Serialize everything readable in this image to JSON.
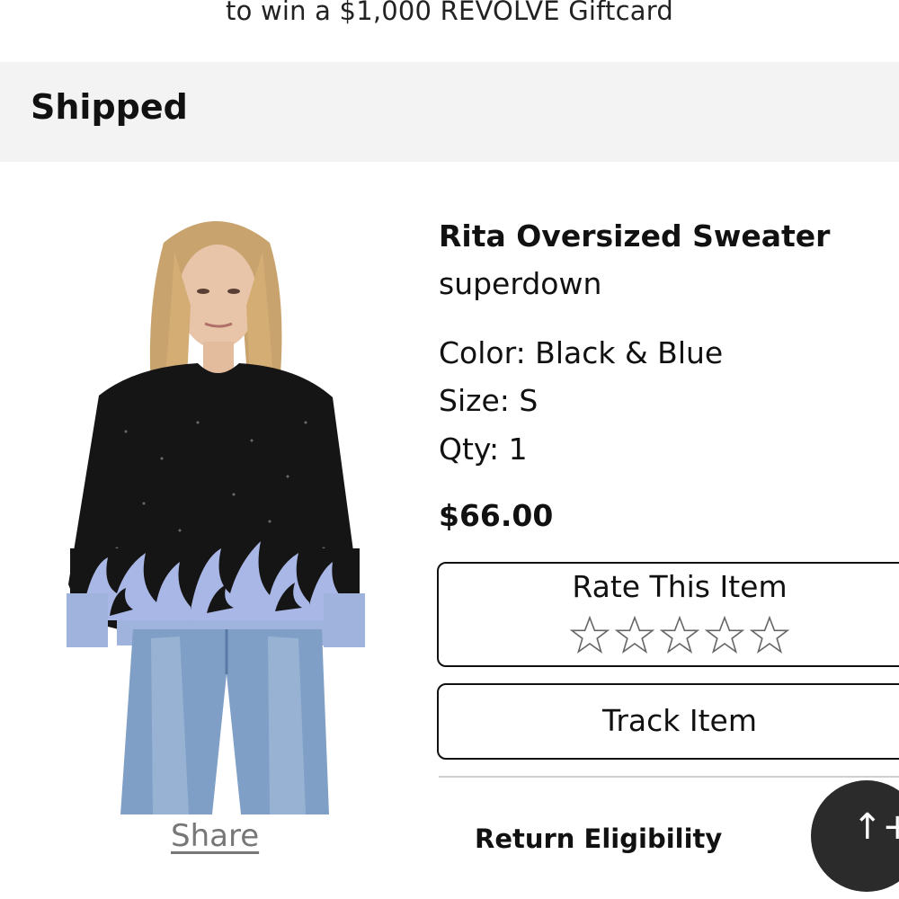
{
  "promo": {
    "text": "to win a $1,000 REVOLVE Giftcard"
  },
  "order": {
    "status": "Shipped"
  },
  "product": {
    "name": "Rita Oversized Sweater",
    "brand": "superdown",
    "color_line": "Color: Black & Blue",
    "size_line": "Size: S",
    "qty_line": "Qty: 1",
    "price": "$66.00",
    "share_label": "Share",
    "image_icon": "product-photo"
  },
  "actions": {
    "rate_label": "Rate This Item",
    "rating": {
      "value": 0,
      "max": 5
    },
    "track_label": "Track Item",
    "return_label": "Return Eligibility"
  },
  "fab": {
    "glyph": "↑+",
    "icon": "scroll-top-icon"
  }
}
